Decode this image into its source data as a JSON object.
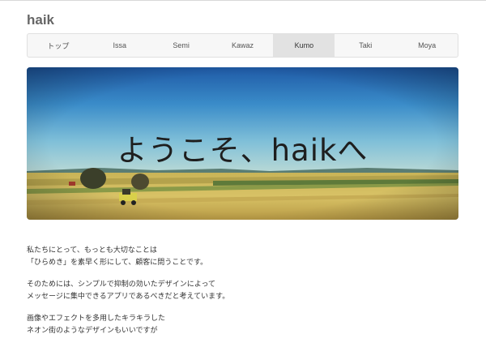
{
  "site": {
    "title": "haik"
  },
  "nav": {
    "items": [
      {
        "label": "トップ"
      },
      {
        "label": "Issa"
      },
      {
        "label": "Semi"
      },
      {
        "label": "Kawaz"
      },
      {
        "label": "Kumo",
        "active": true
      },
      {
        "label": "Taki"
      },
      {
        "label": "Moya"
      }
    ]
  },
  "hero": {
    "title": "ようこそ、haikへ"
  },
  "content": {
    "paragraphs": [
      [
        "私たちにとって、もっとも大切なことは",
        "「ひらめき」を素早く形にして、顧客に問うことです。"
      ],
      [
        "そのためには、シンプルで抑制の効いたデザインによって",
        "メッセージに集中できるアプリであるべきだと考えています。"
      ],
      [
        "画像やエフェクトを多用したキラキラした",
        "ネオン街のようなデザインもいいですが"
      ]
    ]
  },
  "colors": {
    "active_nav_bg": "#e2e2e2",
    "nav_bg": "#f7f7f7"
  }
}
